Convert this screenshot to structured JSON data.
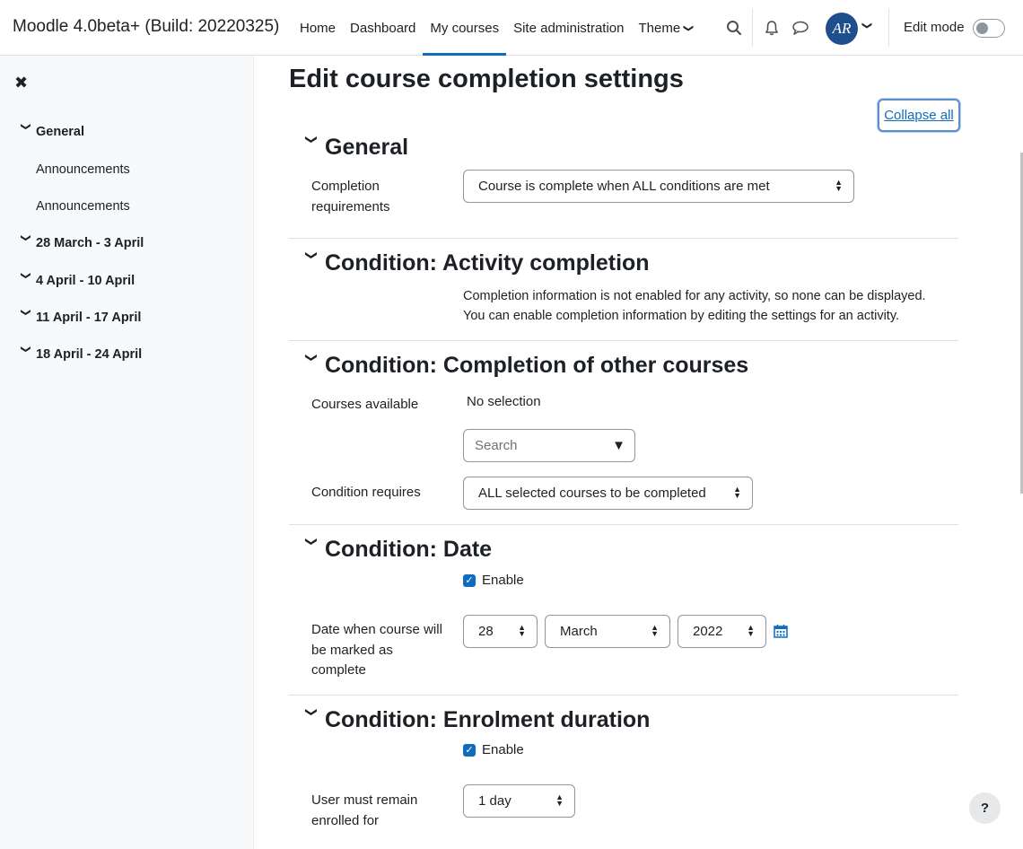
{
  "navbar": {
    "brand": "Moodle 4.0beta+ (Build: 20220325)",
    "links": [
      {
        "label": "Home",
        "active": false
      },
      {
        "label": "Dashboard",
        "active": false
      },
      {
        "label": "My courses",
        "active": true
      },
      {
        "label": "Site administration",
        "active": false
      },
      {
        "label": "Theme",
        "active": false
      }
    ],
    "avatar_initials": "AR",
    "edit_mode_label": "Edit mode",
    "edit_mode_on": false
  },
  "drawer": {
    "close_glyph": "✖",
    "items": [
      {
        "label": "General",
        "type": "section"
      },
      {
        "label": "Announcements",
        "type": "activity"
      },
      {
        "label": "Announcements",
        "type": "activity"
      },
      {
        "label": "28 March - 3 April",
        "type": "section"
      },
      {
        "label": "4 April - 10 April",
        "type": "section"
      },
      {
        "label": "11 April - 17 April",
        "type": "section"
      },
      {
        "label": "18 April - 24 April",
        "type": "section"
      }
    ]
  },
  "main": {
    "page_title": "Edit course completion settings",
    "collapse_all": "Collapse all",
    "sections": {
      "general": {
        "title": "General",
        "completion_requirements_label": "Completion requirements",
        "completion_requirements_value": "Course is complete when ALL conditions are met"
      },
      "activity": {
        "title": "Condition: Activity completion",
        "info_line1": "Completion information is not enabled for any activity, so none can be displayed.",
        "info_line2": "You can enable completion information by editing the settings for an activity."
      },
      "other_courses": {
        "title": "Condition: Completion of other courses",
        "courses_available_label": "Courses available",
        "no_selection": "No selection",
        "search_placeholder": "Search",
        "condition_requires_label": "Condition requires",
        "condition_requires_value": "ALL selected courses to be completed"
      },
      "date": {
        "title": "Condition: Date",
        "enable_label": "Enable",
        "enabled": true,
        "date_label": "Date when course will be marked as complete",
        "day": "28",
        "month": "March",
        "year": "2022"
      },
      "enrolment": {
        "title": "Condition: Enrolment duration",
        "enable_label": "Enable",
        "enabled": true,
        "duration_label": "User must remain enrolled for",
        "duration_value": "1 day"
      }
    }
  },
  "help_glyph": "?",
  "colors": {
    "accent": "#0f6cbf",
    "avatar": "#1f4e8c",
    "border": "#8f959e"
  }
}
